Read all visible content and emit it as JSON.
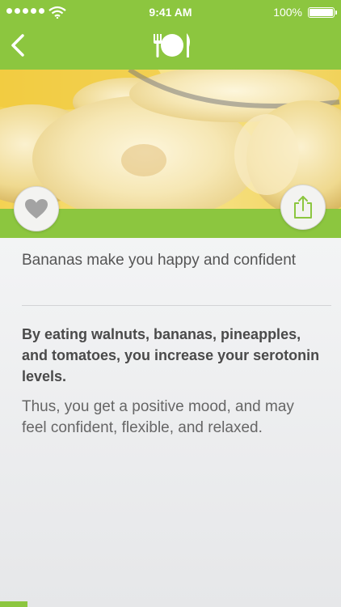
{
  "status_bar": {
    "time": "9:41 AM",
    "battery": "100%"
  },
  "nav": {
    "back_icon": "chevron-left-icon",
    "logo_icon": "fork-plate-knife-icon"
  },
  "actions": {
    "like_icon": "heart-icon",
    "share_icon": "share-icon"
  },
  "tip": {
    "title": "Bananas make you happy and confident",
    "highlight": "By eating walnuts, bananas, pineapples, and tomatoes, you increase your serotonin levels.",
    "body": "Thus, you get a positive mood, and may feel confident, flexible, and relaxed."
  },
  "progress": 0.08,
  "colors": {
    "accent": "#8cc63f",
    "content_bg": "#eeeff0"
  }
}
